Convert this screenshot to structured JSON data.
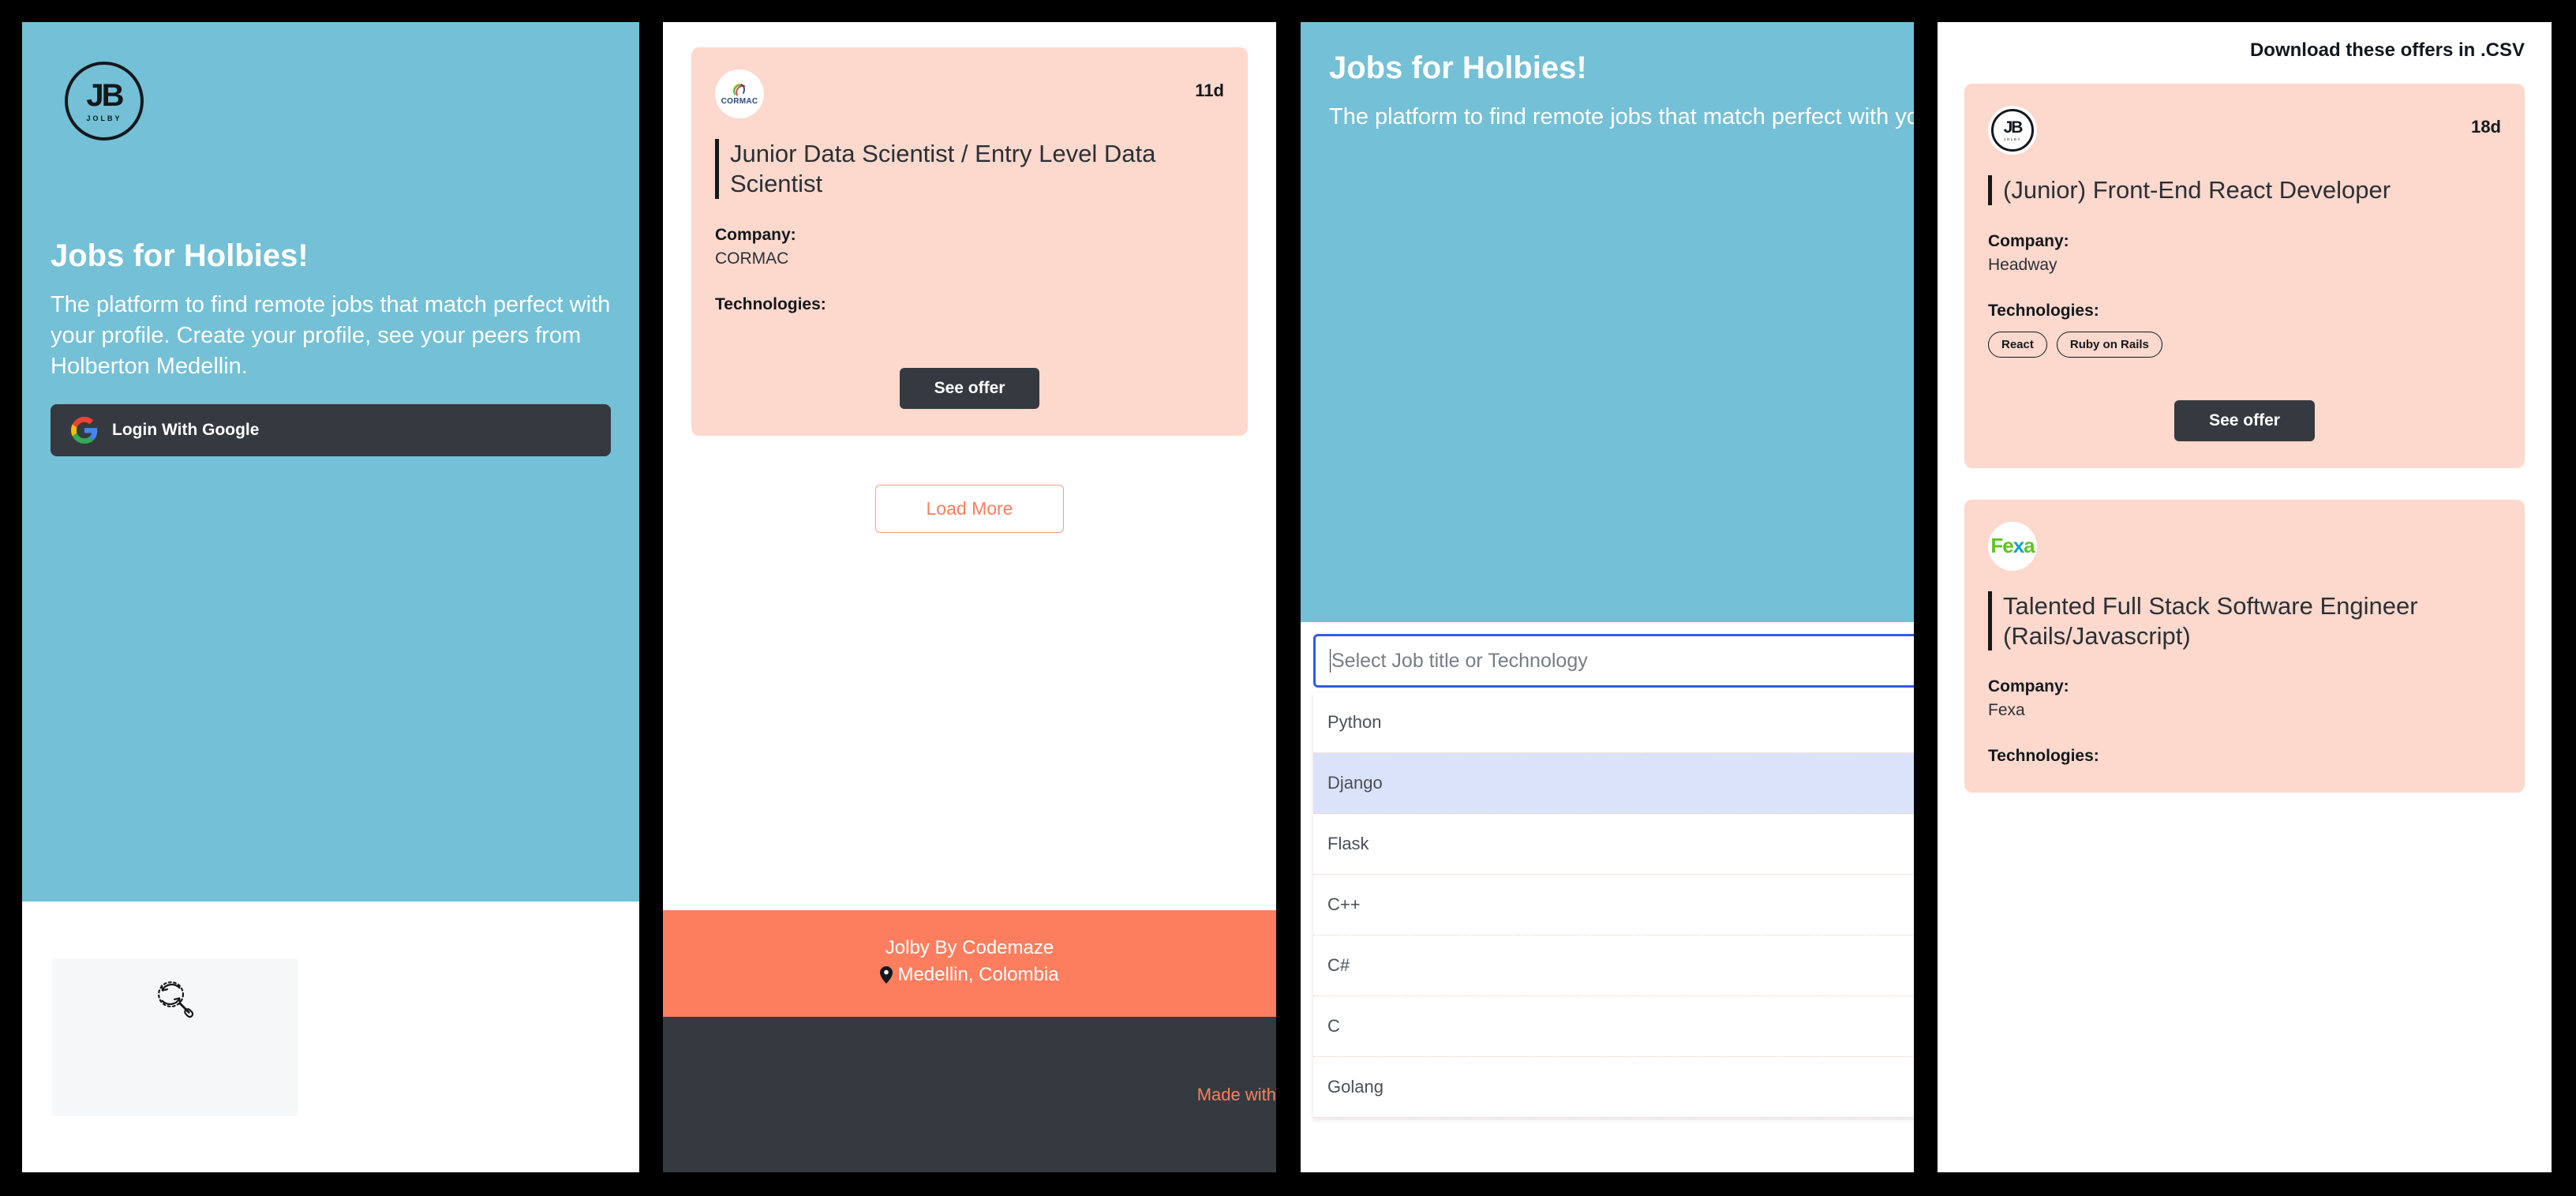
{
  "brand": {
    "logo_initials": "JB",
    "logo_wordmark": "JOLBY",
    "accent_blue": "#74c0d6",
    "accent_salmon": "#fcd8cd",
    "accent_orange": "#fd7e5f",
    "dark": "#343a40"
  },
  "hero": {
    "title": "Jobs for Holbies!",
    "subtitle": "The platform to find remote jobs that match perfect with your profile. Create your profile, see your peers from Holberton Medellin.",
    "login_button": "Login With Google",
    "google_icon": "google-g-icon",
    "search_icon": "refresh-search-icon"
  },
  "panel2": {
    "card": {
      "logo_text": "CORMAC",
      "logo_type": "cormac-logo",
      "posted": "11d",
      "title": "Junior Data Scientist / Entry Level Data Scientist",
      "company_label": "Company:",
      "company_value": "CORMAC",
      "technologies_label": "Technologies:",
      "technologies": [],
      "see_offer": "See offer"
    },
    "load_more": "Load More",
    "footer": {
      "line1": "Jolby By Codemaze",
      "line2": "Medellin, Colombia",
      "pin_icon": "map-pin-icon",
      "made_with": "Made with"
    }
  },
  "panel3": {
    "title": "Jobs for Holbies!",
    "subtitle": "The platform to find remote jobs that match perfect with your profile. Create your profile, see your peers from Holberton Medellin.",
    "select": {
      "placeholder": "Select Job title or Technology",
      "value": "",
      "options": [
        "Python",
        "Django",
        "Flask",
        "C++",
        "C#",
        "C",
        "Golang"
      ],
      "highlighted": "Django"
    }
  },
  "panel4": {
    "download_csv": "Download these offers in .CSV",
    "cards": [
      {
        "logo_type": "jolby-logo",
        "logo_text": "JB",
        "logo_sub": "JOLBY",
        "posted": "18d",
        "title": "(Junior) Front-End React Developer",
        "company_label": "Company:",
        "company_value": "Headway",
        "technologies_label": "Technologies:",
        "technologies": [
          "React",
          "Ruby on Rails"
        ],
        "see_offer": "See offer"
      },
      {
        "logo_type": "fexa-logo",
        "logo_text": "Fexa",
        "posted": "",
        "title": "Talented Full Stack Software Engineer (Rails/Javascript)",
        "company_label": "Company:",
        "company_value": "Fexa",
        "technologies_label": "Technologies:",
        "technologies": [],
        "see_offer": "See offer"
      }
    ]
  }
}
